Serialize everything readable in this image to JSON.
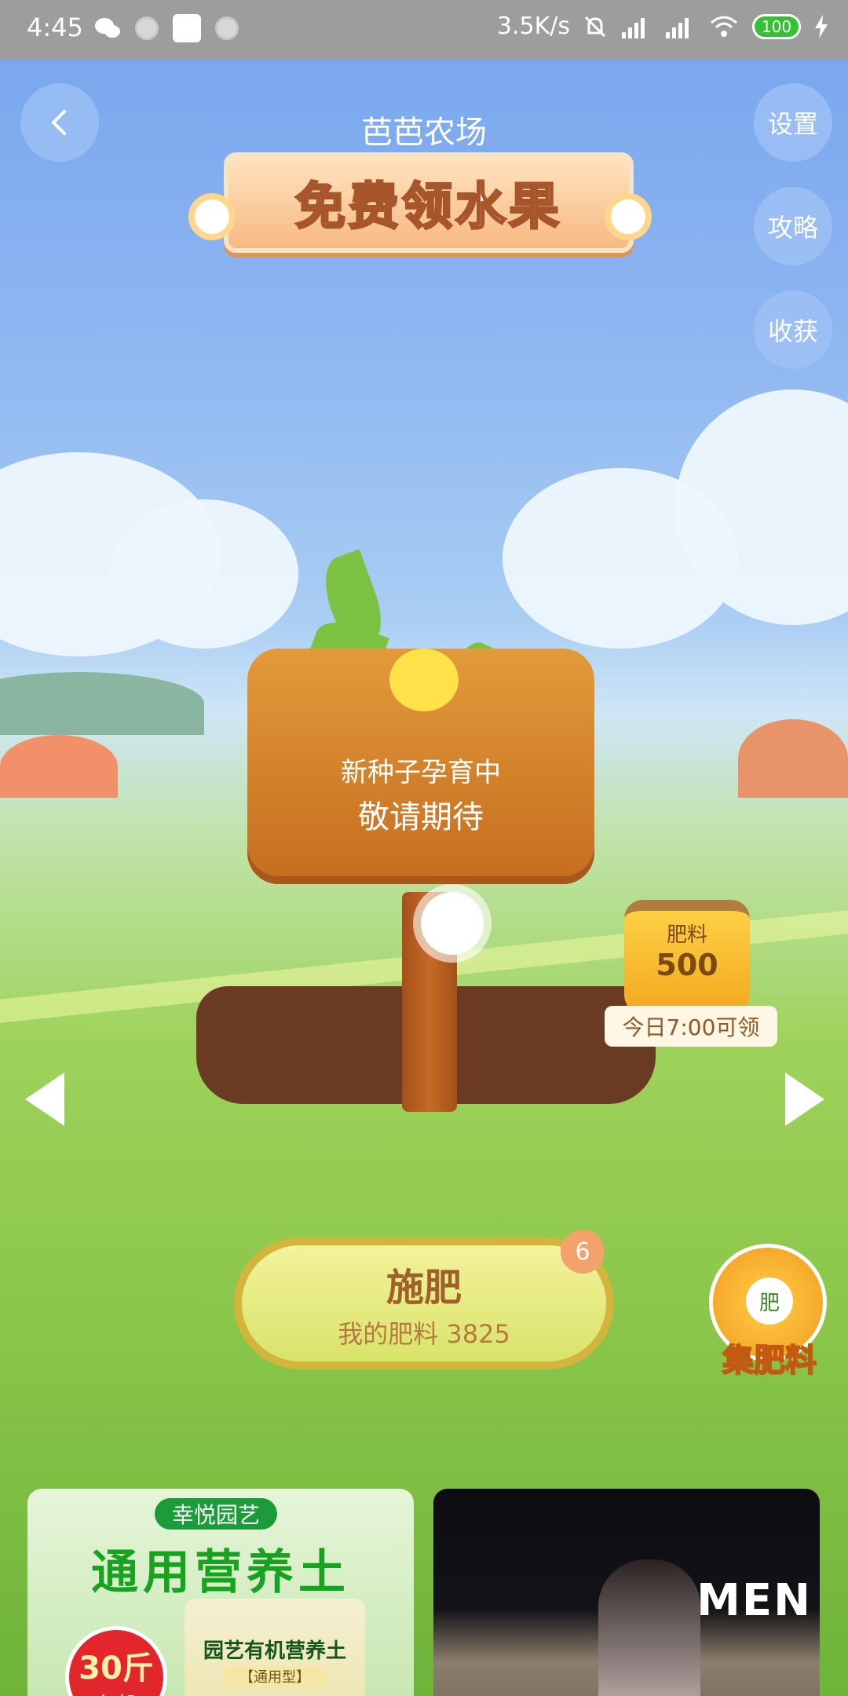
{
  "status_bar": {
    "time": "4:45",
    "network_speed": "3.5K/s",
    "battery": "100"
  },
  "header": {
    "title": "芭芭农场",
    "banner": "免费领水果"
  },
  "side_buttons": {
    "settings": "设置",
    "guide": "攻略",
    "harvest": "收获"
  },
  "sign": {
    "line1": "新种子孕育中",
    "line2": "敬请期待"
  },
  "fertilizer_bag": {
    "label": "肥料",
    "amount": "500",
    "ribbon": "今日7:00可领"
  },
  "fertilize_button": {
    "label": "施肥",
    "sub": "我的肥料 3825",
    "badge": "6"
  },
  "collect_button": {
    "icon_text": "肥",
    "label": "集肥料"
  },
  "cards": {
    "left": {
      "brand": "幸悦园艺",
      "headline": "通用营养土",
      "product": "园艺有机营养土",
      "product_sub": "【通用型】",
      "promo_weight": "30斤",
      "promo_shipping": "包邮"
    },
    "right": {
      "sign_text": "MEN"
    }
  },
  "colors": {
    "sky": "#8fb7f1",
    "grass": "#8cc84b",
    "wood": "#c56d1f",
    "fertilize_text": "#a0602a"
  }
}
